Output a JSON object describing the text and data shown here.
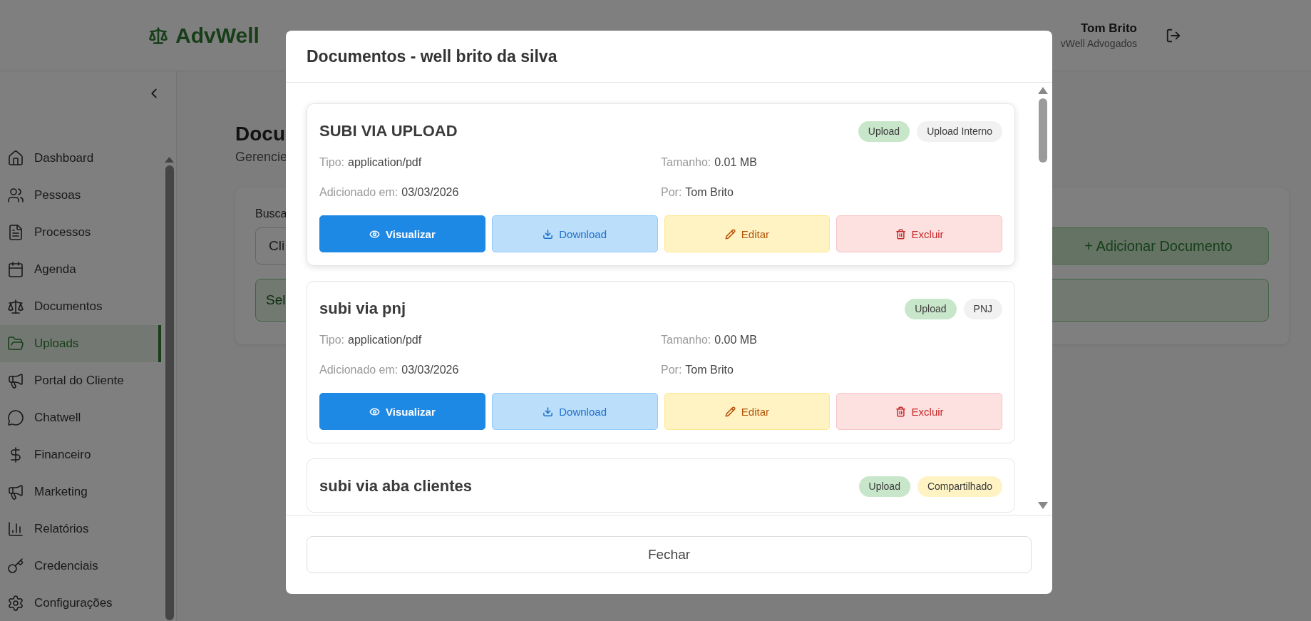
{
  "header": {
    "logo": "AdvWell",
    "user_name": "Tom Brito",
    "user_org": "vWell Advogados"
  },
  "sidebar": {
    "items": [
      {
        "label": "Dashboard",
        "selected": false
      },
      {
        "label": "Pessoas",
        "selected": false
      },
      {
        "label": "Processos",
        "selected": false
      },
      {
        "label": "Agenda",
        "selected": false
      },
      {
        "label": "Documentos",
        "selected": false
      },
      {
        "label": "Uploads",
        "selected": true
      },
      {
        "label": "Portal do Cliente",
        "selected": false
      },
      {
        "label": "Chatwell",
        "selected": false
      },
      {
        "label": "Financeiro",
        "selected": false
      },
      {
        "label": "Marketing",
        "selected": false
      },
      {
        "label": "Relatórios",
        "selected": false
      },
      {
        "label": "Credenciais",
        "selected": false
      },
      {
        "label": "Configurações",
        "selected": false
      }
    ]
  },
  "page": {
    "title": "Docu",
    "subtitle": "Gerencie",
    "search_label": "Busca",
    "search_value": "Cli",
    "add_button": "+ Adicionar Documento",
    "notice": "Sel"
  },
  "modal": {
    "title": "Documentos - well brito da silva",
    "documents": [
      {
        "name": "SUBI VIA UPLOAD",
        "raised": true,
        "tags": [
          {
            "label": "Upload",
            "color": "#c8e6c9"
          },
          {
            "label": "Upload Interno",
            "color": "#f1f1f1"
          }
        ],
        "fields": [
          {
            "label": "Tipo:",
            "value": "application/pdf"
          },
          {
            "label": "Tamanho:",
            "value": "0.01 MB"
          },
          {
            "label": "Adicionado em:",
            "value": "03/03/2026"
          },
          {
            "label": "Por:",
            "value": "Tom Brito"
          }
        ],
        "actions": [
          {
            "label": "Visualizar",
            "kind": "view"
          },
          {
            "label": "Download",
            "kind": "download"
          },
          {
            "label": "Editar",
            "kind": "edit"
          },
          {
            "label": "Excluir",
            "kind": "delete"
          }
        ]
      },
      {
        "name": "subi via pnj",
        "raised": false,
        "tags": [
          {
            "label": "Upload",
            "color": "#c8e6c9"
          },
          {
            "label": "PNJ",
            "color": "#f1f1f1"
          }
        ],
        "fields": [
          {
            "label": "Tipo:",
            "value": "application/pdf"
          },
          {
            "label": "Tamanho:",
            "value": "0.00 MB"
          },
          {
            "label": "Adicionado em:",
            "value": "03/03/2026"
          },
          {
            "label": "Por:",
            "value": "Tom Brito"
          }
        ],
        "actions": [
          {
            "label": "Visualizar",
            "kind": "view"
          },
          {
            "label": "Download",
            "kind": "download"
          },
          {
            "label": "Editar",
            "kind": "edit"
          },
          {
            "label": "Excluir",
            "kind": "delete"
          }
        ]
      },
      {
        "name": "subi via aba clientes",
        "raised": false,
        "tags": [
          {
            "label": "Upload",
            "color": "#c8e6c9"
          },
          {
            "label": "Compartilhado",
            "color": "#fff3c4"
          }
        ]
      }
    ],
    "close_button": "Fechar"
  }
}
